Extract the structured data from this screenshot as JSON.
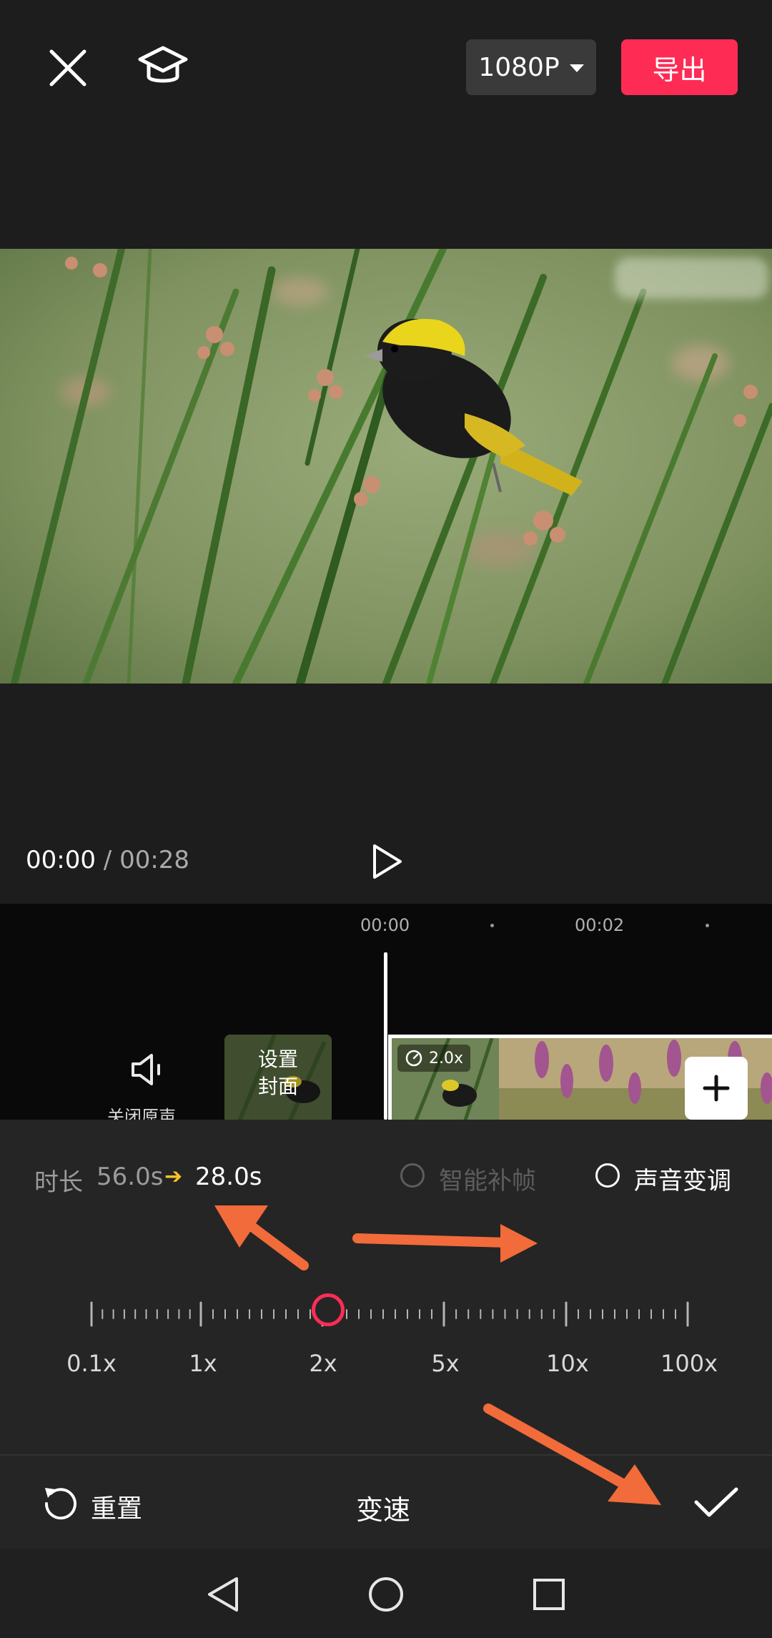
{
  "header": {
    "resolution_label": "1080P",
    "export_label": "导出",
    "accent_color": "#fe2c55"
  },
  "player": {
    "current_time": "00:00",
    "separator": " / ",
    "total_time": "00:28"
  },
  "timeline": {
    "ticks": [
      "00:00",
      "00:02"
    ],
    "mute_label": "关闭原声",
    "cover_label_line1": "设置",
    "cover_label_line2": "封面",
    "clip_speed_badge": "2.0x"
  },
  "speed_panel": {
    "duration_label": "时长",
    "original_duration": "56.0s",
    "arrow": "➔",
    "new_duration": "28.0s",
    "frame_interpolation_label": "智能补帧",
    "frame_interpolation_enabled": false,
    "pitch_shift_label": "声音变调",
    "pitch_shift_checked": false,
    "scale_labels": [
      "0.1x",
      "1x",
      "2x",
      "5x",
      "10x",
      "100x"
    ],
    "selected_speed": "2x"
  },
  "action_bar": {
    "reset_label": "重置",
    "title": "变速"
  },
  "annotation_color": "#f26b3a"
}
